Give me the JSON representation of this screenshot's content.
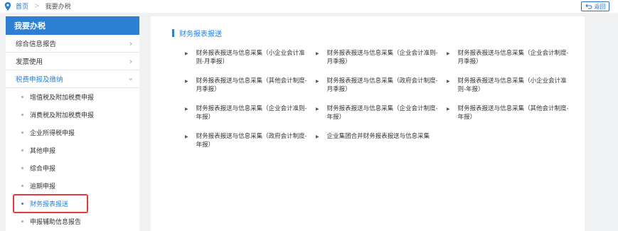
{
  "breadcrumb": {
    "home": "首页",
    "separator": ">",
    "current": "我要办税"
  },
  "back_button": {
    "label": "返回"
  },
  "sidebar": {
    "header": "我要办税",
    "items": [
      {
        "label": "综合信息报告",
        "chevron": "›"
      },
      {
        "label": "发票使用",
        "chevron": "›"
      },
      {
        "label": "税费申报及缴纳",
        "chevron": "›"
      }
    ],
    "sub_items": [
      {
        "label": "增值税及附加税费申报"
      },
      {
        "label": "消费税及附加税费申报"
      },
      {
        "label": "企业所得税申报"
      },
      {
        "label": "其他申报"
      },
      {
        "label": "综合申报"
      },
      {
        "label": "逾期申报"
      },
      {
        "label": "财务报表报送"
      },
      {
        "label": "申报辅助信息报告"
      }
    ]
  },
  "main": {
    "title": "财务报表报送",
    "links": [
      {
        "label": "财务报表报送与信息采集（小企业会计准则-月季报）"
      },
      {
        "label": "财务报表报送与信息采集（企业会计准则-月季报）"
      },
      {
        "label": "财务报表报送与信息采集（企业会计制度-月季报）"
      },
      {
        "label": "财务报表报送与信息采集（其他会计制度-月季报）"
      },
      {
        "label": "财务报表报送与信息采集（政府会计制度-月季报）"
      },
      {
        "label": "财务报表报送与信息采集（小企业会计准则-年报）"
      },
      {
        "label": "财务报表报送与信息采集（企业会计准则-年报）"
      },
      {
        "label": "财务报表报送与信息采集（企业会计制度-年报）"
      },
      {
        "label": "财务报表报送与信息采集（其他会计制度-年报）"
      },
      {
        "label": "财务报表报送与信息采集（政府会计制度-年报）"
      },
      {
        "label": "企业集团合并财务报表报送与信息采集"
      }
    ]
  },
  "colors": {
    "accent": "#2d7fd3",
    "highlight": "#e53a3a",
    "band": "#f0f1f3"
  }
}
